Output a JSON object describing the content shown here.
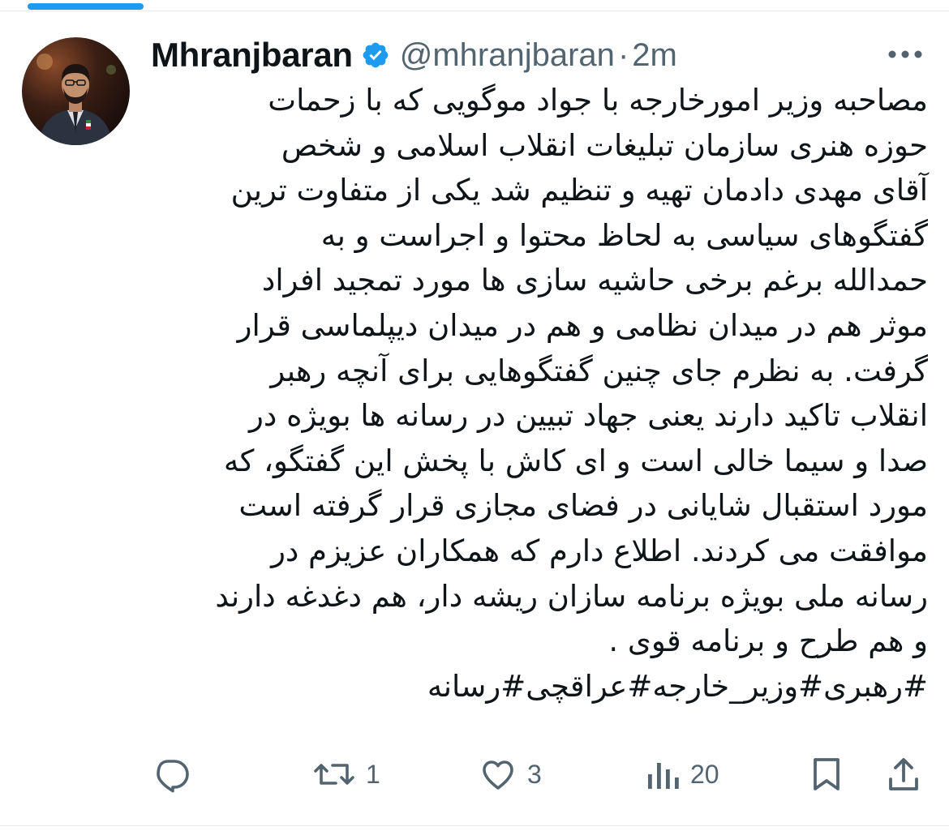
{
  "user": {
    "display_name": "Mhranjbaran",
    "handle": "@mhranjbaran",
    "separator": "·",
    "time": "2m"
  },
  "tweet": {
    "lines": [
      "مصاحبه وزیر امورخارجه با جواد موگویی که با زحمات",
      "حوزه هنری سازمان تبلیغات انقلاب اسلامی و شخص",
      "آقای مهدی دادمان تهیه و تنظیم شد یکی از متفاوت ترین",
      "گفتگوهای سیاسی به لحاظ محتوا و اجراست و به",
      "حمدالله برغم برخی حاشیه سازی ها مورد تمجید افراد",
      "موثر هم در میدان نظامی و هم در میدان دیپلماسی قرار",
      "گرفت. به نظرم جای چنین گفتگوهایی برای آنچه رهبر",
      "انقلاب تاکید دارند یعنی جهاد تبیین در رسانه ها بویژه در",
      "صدا و سیما خالی است و ای کاش با پخش این گفتگو، که",
      "مورد استقبال شایانی در فضای مجازی قرار گرفته است",
      "موافقت می کردند. اطلاع دارم که همکاران عزیزم در",
      "رسانه ملی بویژه برنامه سازان ریشه دار، هم دغدغه دارند",
      "و هم طرح و برنامه قوی ."
    ],
    "hashtags": [
      "#رهبری",
      "#وزیر_خارجه",
      "#عراقچی",
      "#رسانه"
    ]
  },
  "actions": {
    "reply_icon": "reply-icon",
    "retweet_icon": "retweet-icon",
    "retweet_count": "1",
    "like_icon": "heart-icon",
    "like_count": "3",
    "views_icon": "views-icon",
    "views_count": "20",
    "bookmark_icon": "bookmark-icon",
    "share_icon": "share-icon"
  },
  "colors": {
    "accent": "#1d9bf0",
    "text": "#0f1419",
    "muted": "#536471"
  }
}
